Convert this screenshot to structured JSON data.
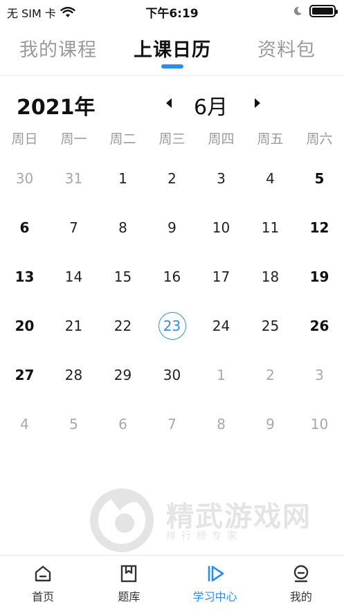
{
  "status_bar": {
    "carrier": "无 SIM 卡",
    "time": "下午6:19"
  },
  "top_tabs": [
    {
      "label": "我的课程",
      "active": false
    },
    {
      "label": "上课日历",
      "active": true
    },
    {
      "label": "资料包",
      "active": false
    }
  ],
  "calendar": {
    "year": "2021年",
    "month": "6月",
    "weekdays": [
      "周日",
      "周一",
      "周二",
      "周三",
      "周四",
      "周五",
      "周六"
    ],
    "days": [
      [
        "30",
        "31",
        "1",
        "2",
        "3",
        "4",
        "5"
      ],
      [
        "6",
        "7",
        "8",
        "9",
        "10",
        "11",
        "12"
      ],
      [
        "13",
        "14",
        "15",
        "16",
        "17",
        "18",
        "19"
      ],
      [
        "20",
        "21",
        "22",
        "23",
        "24",
        "25",
        "26"
      ],
      [
        "27",
        "28",
        "29",
        "30",
        "1",
        "2",
        "3"
      ],
      [
        "4",
        "5",
        "6",
        "7",
        "8",
        "9",
        "10"
      ]
    ],
    "today": "23"
  },
  "watermark": {
    "title": "精武游戏网",
    "subtitle": "排行榜专家"
  },
  "bottom_nav": [
    {
      "label": "首页",
      "icon": "home-icon",
      "active": false
    },
    {
      "label": "题库",
      "icon": "bookmark-icon",
      "active": false
    },
    {
      "label": "学习中心",
      "icon": "play-icon",
      "active": true
    },
    {
      "label": "我的",
      "icon": "profile-icon",
      "active": false
    }
  ],
  "colors": {
    "accent": "#2a8cf0",
    "muted_text": "#9a9a9a"
  }
}
